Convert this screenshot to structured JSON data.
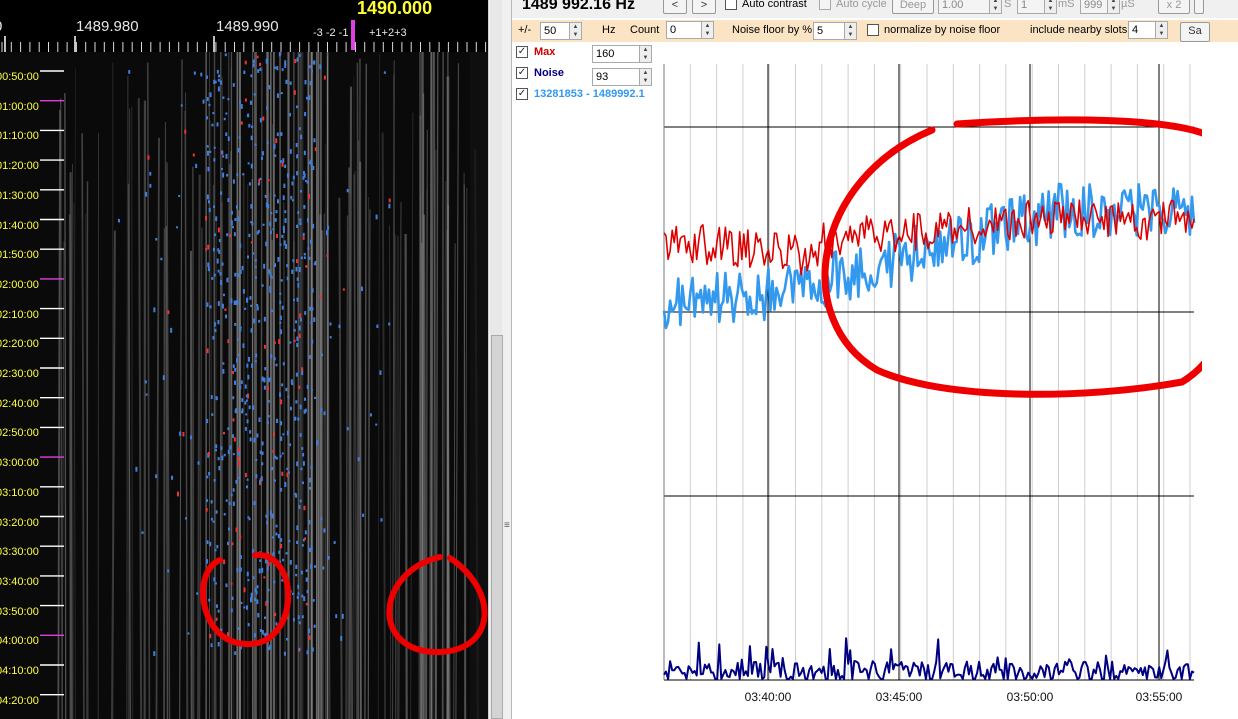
{
  "waterfall": {
    "freq_labels": [
      {
        "text": "0",
        "left": 0
      },
      {
        "text": "1489.980",
        "left": 76
      },
      {
        "text": "1489.990",
        "left": 216
      }
    ],
    "center_freq": "1490.000",
    "slot_minus": "-3 -2 -1",
    "slot_plus": "+1+2+3",
    "time_labels": [
      "00:50:00",
      "01:00:00",
      "01:10:00",
      "01:20:00",
      "01:30:00",
      "01:40:00",
      "01:50:00",
      "02:00:00",
      "02:10:00",
      "02:20:00",
      "02:30:00",
      "02:40:00",
      "02:50:00",
      "03:00:00",
      "03:10:00",
      "03:20:00",
      "03:30:00",
      "03:40:00",
      "03:50:00",
      "04:00:00",
      "04:10:00",
      "04:20:00"
    ],
    "colors": {
      "time_label": "#ffff44",
      "hour_marker": "#e040e0",
      "annotation": "#ee0000"
    }
  },
  "toolbar": {
    "freq_readout": "1489 992.16 Hz",
    "prev_label": "<",
    "next_label": ">",
    "auto_contrast_label": "Auto contrast",
    "auto_cycle_label": "Auto cycle",
    "deep_label": "Deep",
    "gain_value": "1.00",
    "s_label": "S",
    "ms_value": "1",
    "ms_label": "mS",
    "us_value": "999",
    "us_label": "µS",
    "x2_label": "x 2",
    "plusminus_label": "+/-",
    "plusminus_value": "50",
    "hz_label": "Hz",
    "count_label": "Count",
    "count_value": "0",
    "noise_floor_label": "Noise floor by %",
    "noise_floor_value": "5",
    "normalize_label": "normalize by noise floor",
    "nearby_label": "include nearby slots:",
    "nearby_value": "4",
    "save_label": "Sa"
  },
  "series_list": [
    {
      "name": "Max",
      "value": "160",
      "color": "#cc0000",
      "checked": true
    },
    {
      "name": "Noise",
      "value": "93",
      "color": "#000080",
      "checked": true
    },
    {
      "name": "13281853 - 1489992.1",
      "value": "",
      "color": "#3399ee",
      "checked": true
    }
  ],
  "chart_data": {
    "type": "line",
    "x_ticks": [
      "03:40:00",
      "03:45:00",
      "03:50:00",
      "03:55:00"
    ],
    "series": [
      {
        "name": "Max",
        "color": "#dd0000"
      },
      {
        "name": "Noise",
        "color": "#000080"
      },
      {
        "name": "13281853 - 1489992.1",
        "color": "#3399ee"
      }
    ],
    "grid": true
  }
}
